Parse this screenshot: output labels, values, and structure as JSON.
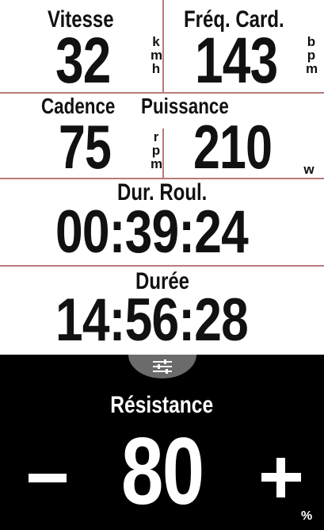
{
  "metrics": {
    "speed": {
      "label": "Vitesse",
      "value": "32",
      "unit": [
        "k",
        "m",
        "h"
      ]
    },
    "heart_rate": {
      "label": "Fréq. Card.",
      "value": "143",
      "unit": [
        "b",
        "p",
        "m"
      ]
    },
    "cadence": {
      "label": "Cadence",
      "value": "75",
      "unit": [
        "r",
        "p",
        "m"
      ]
    },
    "power": {
      "label": "Puissance",
      "value": "210",
      "unit": "w"
    },
    "ride_time": {
      "label": "Dur. Roul.",
      "value": "00:39:24"
    },
    "duration": {
      "label": "Durée",
      "value": "14:56:28"
    }
  },
  "resistance": {
    "label": "Résistance",
    "value": "80",
    "unit": "%",
    "settings_icon": "sliders-icon",
    "decrease_icon": "minus-icon",
    "increase_icon": "plus-icon"
  },
  "colors": {
    "divider": "#b87b7b",
    "panel_bg": "#000000",
    "tab_bg": "#6b6b6b",
    "text": "#111111"
  }
}
